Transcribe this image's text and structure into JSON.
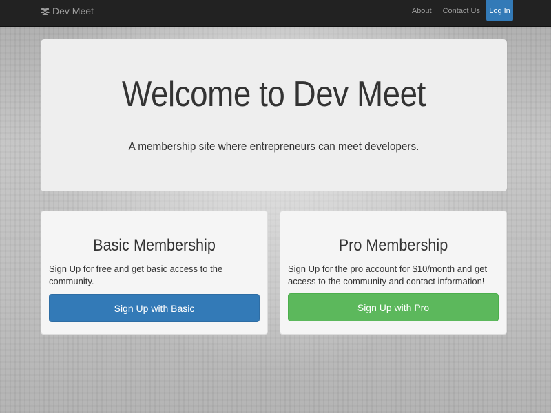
{
  "navbar": {
    "brand": "Dev Meet",
    "brand_icon": "users-icon",
    "links": [
      {
        "label": "About"
      },
      {
        "label": "Contact Us"
      }
    ],
    "login_label": "Log In"
  },
  "jumbotron": {
    "title": "Welcome to Dev Meet",
    "subtitle": "A membership site where entrepreneurs can meet developers."
  },
  "plans": {
    "basic": {
      "title": "Basic Membership",
      "description": "Sign Up for free and get basic access to the community.",
      "button_label": "Sign Up with Basic",
      "button_color": "#337ab7"
    },
    "pro": {
      "title": "Pro Membership",
      "description": "Sign Up for the pro account for $10/month and get access to the community and contact information!",
      "button_label": "Sign Up with Pro",
      "button_color": "#5cb85c"
    }
  }
}
